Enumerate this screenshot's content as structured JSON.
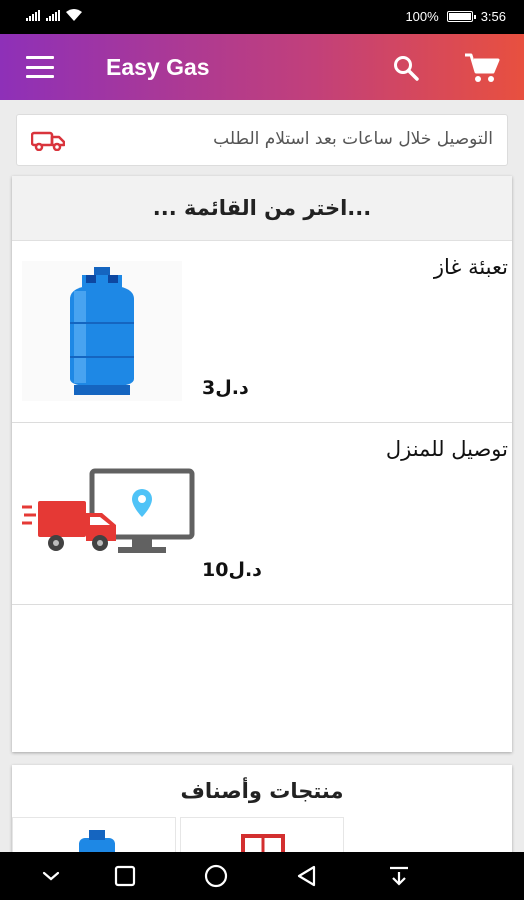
{
  "status_bar": {
    "left_indicators": [
      "signal-icon",
      "signal-icon",
      "wifi-icon"
    ],
    "battery_percent": "100%",
    "battery_level": 1.0,
    "time": "3:56"
  },
  "app_bar": {
    "title": "Easy Gas",
    "icons": [
      "menu-icon",
      "search-icon",
      "cart-icon"
    ],
    "gradient_colors": [
      "#8e30b8",
      "#e8503f"
    ]
  },
  "delivery_banner": {
    "text": "التوصيل خلال ساعات بعد استلام الطلب",
    "icon": "truck-icon",
    "icon_color": "#d9343c"
  },
  "menu": {
    "header": "...اختر من القائمة ...",
    "items": [
      {
        "name": "تعبئة غاز",
        "price": "د.ل3",
        "image": "gas-cylinder-image"
      },
      {
        "name": "توصيل للمنزل",
        "price": "د.ل10",
        "image": "delivery-truck-image"
      }
    ]
  },
  "categories": {
    "header": "منتجات وأصناف",
    "thumbnails": [
      "gas-cylinder-thumb",
      "product-thumb"
    ]
  },
  "nav_bar": {
    "icons": [
      "hide-icon",
      "recents-icon",
      "home-icon",
      "back-icon",
      "notifications-icon"
    ]
  }
}
